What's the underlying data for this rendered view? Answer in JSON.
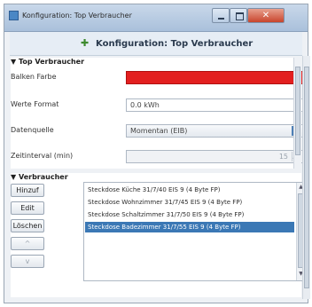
{
  "window": {
    "title": "Konfiguration: Top Verbraucher",
    "icon": "app-icon",
    "buttons": {
      "close": "✕"
    }
  },
  "header": {
    "title": "Konfiguration: Top Verbraucher",
    "icon": "plus-icon"
  },
  "top_section": {
    "heading": "Top Verbraucher",
    "fields": {
      "bar_color": {
        "label": "Balken Farbe",
        "color": "#e31f1f"
      },
      "value_format": {
        "label": "Werte Format",
        "value": "0.0 kWh"
      },
      "data_source": {
        "label": "Datenquelle",
        "value": "Momentan (EIB)"
      },
      "interval": {
        "label": "Zeitinterval (min)",
        "value": "15"
      }
    }
  },
  "verbraucher_section": {
    "heading": "Verbraucher",
    "buttons": {
      "add": "Hinzuf",
      "edit": "Edit",
      "delete": "Löschen",
      "up": "^",
      "down": "v"
    },
    "items": [
      "Steckdose Küche 31/7/40 EIS 9 (4 Byte FP)",
      "Steckdose Wohnzimmer 31/7/45 EIS 9 (4 Byte FP)",
      "Steckdose Schaltzimmer 31/7/50 EIS 9 (4 Byte FP)",
      "Steckdose Badezimmer 31/7/55 EIS 9 (4 Byte FP)"
    ],
    "selected_index": 3
  }
}
